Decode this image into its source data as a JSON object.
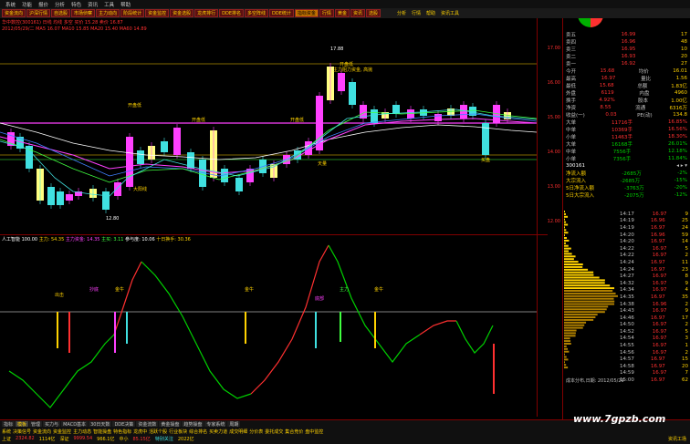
{
  "menu": [
    "系统",
    "功能",
    "报价",
    "分析",
    "特色",
    "资讯",
    "工具",
    "帮助"
  ],
  "toolbar": {
    "buttons": [
      "资金流向",
      "沪深行情",
      "自选股",
      "市场侦察",
      "主力动向",
      "阶段统计",
      "资金监控",
      "资金选股",
      "龙虎排行",
      "DDE排名",
      "多空阵线",
      "DDE统计",
      "指标资金",
      "行情",
      "黄金",
      "资讯",
      "选股"
    ],
    "active_index": 12,
    "right_items": [
      "分析",
      "行情",
      "帮助",
      "资讯工具"
    ]
  },
  "stock_info": {
    "line1": "华中数控(300161) 日线 均线 多空  买价 15.28  卖价 16.87",
    "line2": "2012/05/29/二  MA5 16.07  MA10 15.85  MA20 15.40  MA60 14.89"
  },
  "top_chart": {
    "annotations": [
      "17.88",
      "开盘低",
      "主力阻力资金, 高抛",
      "开盘低",
      "开盘低",
      "开盘低",
      "12.80",
      "大阳线",
      "天量",
      "买盘"
    ]
  },
  "indicator": {
    "name": "人工智能",
    "value": "100.00",
    "items": [
      {
        "label": "主力",
        "value": "54.35",
        "color": "#ffd200"
      },
      {
        "label": "主力资金",
        "value": "14.35",
        "color": "#ff40ff"
      },
      {
        "label": "主买",
        "value": "3.11",
        "color": "#40ff40"
      },
      {
        "label": "参与度",
        "value": "10.06",
        "color": "#ffffff"
      },
      {
        "label": "十日换手",
        "value": "30.36",
        "color": "#ffd200"
      }
    ],
    "labels": [
      "出击",
      "抄底",
      "金牛",
      "金牛",
      "底部",
      "主力",
      "金牛"
    ]
  },
  "price_axis": [
    "17.00",
    "16.00",
    "15.00",
    "14.00",
    "13.00",
    "12.00"
  ],
  "quote": {
    "buy_sell": [
      {
        "label": "卖五",
        "price": "16.99",
        "vol": "17"
      },
      {
        "label": "卖四",
        "price": "16.96",
        "vol": "48"
      },
      {
        "label": "卖三",
        "price": "16.95",
        "vol": "10"
      },
      {
        "label": "卖二",
        "price": "16.93",
        "vol": "20"
      },
      {
        "label": "卖一",
        "price": "16.92",
        "vol": "27"
      }
    ],
    "stats": [
      {
        "l1": "今开",
        "v1": "15.68",
        "l2": "均价",
        "v2": "16.01"
      },
      {
        "l1": "最高",
        "v1": "16.97",
        "l2": "量比",
        "v2": "1.56"
      },
      {
        "l1": "最低",
        "v1": "15.68",
        "l2": "总额",
        "v2": "1.83亿"
      },
      {
        "l1": "外盘",
        "v1": "6119",
        "l2": "内盘",
        "v2": "4960"
      },
      {
        "l1": "换手",
        "v1": "4.92%",
        "l2": "股本",
        "v2": "1.00亿"
      },
      {
        "l1": "净资",
        "v1": "8.55",
        "l2": "流通",
        "v2": "6316万"
      },
      {
        "l1": "收益(一)",
        "v1": "0.03",
        "l2": "PE(动)",
        "v2": "134.8"
      }
    ],
    "flows": [
      {
        "label": "大单",
        "bar": "11716手",
        "pct": "16.85%"
      },
      {
        "label": "中单",
        "bar": "10369手",
        "pct": "16.56%"
      },
      {
        "label": "小单",
        "bar": "11463手",
        "pct": "18.30%"
      },
      {
        "label": "大单",
        "bar": "16168手",
        "pct": "26.01%"
      },
      {
        "label": "中单",
        "bar": "7556手",
        "pct": "12.18%"
      },
      {
        "label": "小单",
        "bar": "7356手",
        "pct": "11.84%"
      }
    ],
    "code": "300161",
    "netflow": [
      {
        "label": "净流入额",
        "value": "-2685万",
        "pct": "-2%"
      },
      {
        "label": "大宗流入",
        "value": "-2685万",
        "pct": "-15%"
      },
      {
        "label": "5日净流入额",
        "value": "-3763万",
        "pct": "-20%"
      },
      {
        "label": "5日大宗流入",
        "value": "-2075万",
        "pct": "-12%"
      }
    ]
  },
  "ticks": [
    {
      "t": "14:17",
      "p": "16.97",
      "v": "9"
    },
    {
      "t": "14:19",
      "p": "16.96",
      "v": "25"
    },
    {
      "t": "14:19",
      "p": "16.97",
      "v": "24"
    },
    {
      "t": "14:20",
      "p": "16.96",
      "v": "59"
    },
    {
      "t": "14:20",
      "p": "16.97",
      "v": "14"
    },
    {
      "t": "14:22",
      "p": "16.97",
      "v": "5"
    },
    {
      "t": "14:22",
      "p": "16.97",
      "v": "2"
    },
    {
      "t": "14:24",
      "p": "16.97",
      "v": "11"
    },
    {
      "t": "14:24",
      "p": "16.97",
      "v": "23"
    },
    {
      "t": "14:27",
      "p": "16.97",
      "v": "8"
    },
    {
      "t": "14:32",
      "p": "16.97",
      "v": "9"
    },
    {
      "t": "14:34",
      "p": "16.97",
      "v": "4"
    },
    {
      "t": "14:35",
      "p": "16.97",
      "v": "35"
    },
    {
      "t": "14:38",
      "p": "16.96",
      "v": "2"
    },
    {
      "t": "14:43",
      "p": "16.97",
      "v": "9"
    },
    {
      "t": "14:46",
      "p": "16.97",
      "v": "17"
    },
    {
      "t": "14:50",
      "p": "16.97",
      "v": "2"
    },
    {
      "t": "14:52",
      "p": "16.97",
      "v": "5"
    },
    {
      "t": "14:54",
      "p": "16.97",
      "v": "3"
    },
    {
      "t": "14:55",
      "p": "16.97",
      "v": "1"
    },
    {
      "t": "14:56",
      "p": "16.97",
      "v": "2"
    },
    {
      "t": "14:57",
      "p": "16.97",
      "v": "15"
    },
    {
      "t": "14:58",
      "p": "16.97",
      "v": "20"
    },
    {
      "t": "14:59",
      "p": "16.97",
      "v": "7"
    },
    {
      "t": "15:00",
      "p": "16.97",
      "v": "62"
    }
  ],
  "cost_dist": {
    "label": "成本分布,日期: 2012/05/29"
  },
  "bottom": {
    "tabs": [
      "指标",
      "模板",
      "管理",
      "买力与",
      "MACD基本",
      "30日天数",
      "DDE决策",
      "资金流数",
      "黄金操盘",
      "趋势操盘",
      "专家系统",
      "周期"
    ],
    "active_tab": 1,
    "tabs2": [
      "系统",
      "决策信号",
      "资金流向",
      "资金监控",
      "主力动态",
      "智能操盘",
      "特色指标",
      "龙虎中",
      "活跃个股",
      "行业板块",
      "综合排名",
      "买卖力道",
      "成交明细",
      "分价表",
      "委托成交",
      "集合竞价",
      "盘中监控"
    ],
    "status": [
      {
        "text": "上证",
        "color": "#ffd200"
      },
      {
        "text": "2324.82",
        "color": "#ff3030"
      },
      {
        "text": "1114亿",
        "color": "#ffd200"
      },
      {
        "text": "深证",
        "color": "#ffd200"
      },
      {
        "text": "9999.54",
        "color": "#ff3030"
      },
      {
        "text": "966.1亿",
        "color": "#ffd200"
      },
      {
        "text": "中小",
        "color": "#ffd200"
      },
      {
        "text": "85.15亿",
        "color": "#ff3030"
      },
      {
        "text": "特别关注",
        "color": "#40e0e0"
      },
      {
        "text": "2022亿",
        "color": "#ffd200"
      }
    ],
    "corner": "资讯工场"
  },
  "watermark": "www.7gpzb.com",
  "colors": {
    "red": "#ff3030",
    "green": "#00d000",
    "yellow": "#ffd200",
    "magenta": "#ff40ff",
    "cyan": "#40e0e0"
  }
}
